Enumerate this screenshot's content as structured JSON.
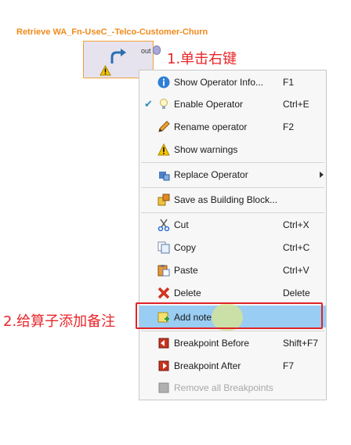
{
  "operator": {
    "title": "Retrieve WA_Fn-UseC_-Telco-Customer-Churn",
    "port_label": "out"
  },
  "annotations": {
    "step1": "1.单击右键",
    "step2": "2.给算子添加备注"
  },
  "menu": {
    "items": [
      {
        "label": "Show Operator Info...",
        "shortcut": "F1",
        "icon": "info-icon"
      },
      {
        "label": "Enable Operator",
        "shortcut": "Ctrl+E",
        "icon": "lightbulb-icon",
        "checked": "✔"
      },
      {
        "label": "Rename operator",
        "shortcut": "F2",
        "icon": "pencil-icon"
      },
      {
        "label": "Show warnings",
        "shortcut": "",
        "icon": "warning-icon"
      },
      {
        "label": "Replace Operator",
        "shortcut": "",
        "icon": "replace-icon"
      },
      {
        "label": "Save as Building Block...",
        "shortcut": "",
        "icon": "building-block-icon"
      },
      {
        "label": "Cut",
        "shortcut": "Ctrl+X",
        "icon": "scissors-icon"
      },
      {
        "label": "Copy",
        "shortcut": "Ctrl+C",
        "icon": "copy-icon"
      },
      {
        "label": "Paste",
        "shortcut": "Ctrl+V",
        "icon": "paste-icon"
      },
      {
        "label": "Delete",
        "shortcut": "Delete",
        "icon": "delete-icon"
      },
      {
        "label": "Add note",
        "shortcut": "",
        "icon": "note-icon"
      },
      {
        "label": "Breakpoint Before",
        "shortcut": "Shift+F7",
        "icon": "breakpoint-before-icon"
      },
      {
        "label": "Breakpoint After",
        "shortcut": "F7",
        "icon": "breakpoint-after-icon"
      },
      {
        "label": "Remove all Breakpoints",
        "shortcut": "",
        "icon": "remove-breakpoints-icon"
      }
    ]
  },
  "colors": {
    "operator_title": "#f08a1c",
    "annotation": "#e8262a",
    "highlight": "#99cdf3"
  }
}
